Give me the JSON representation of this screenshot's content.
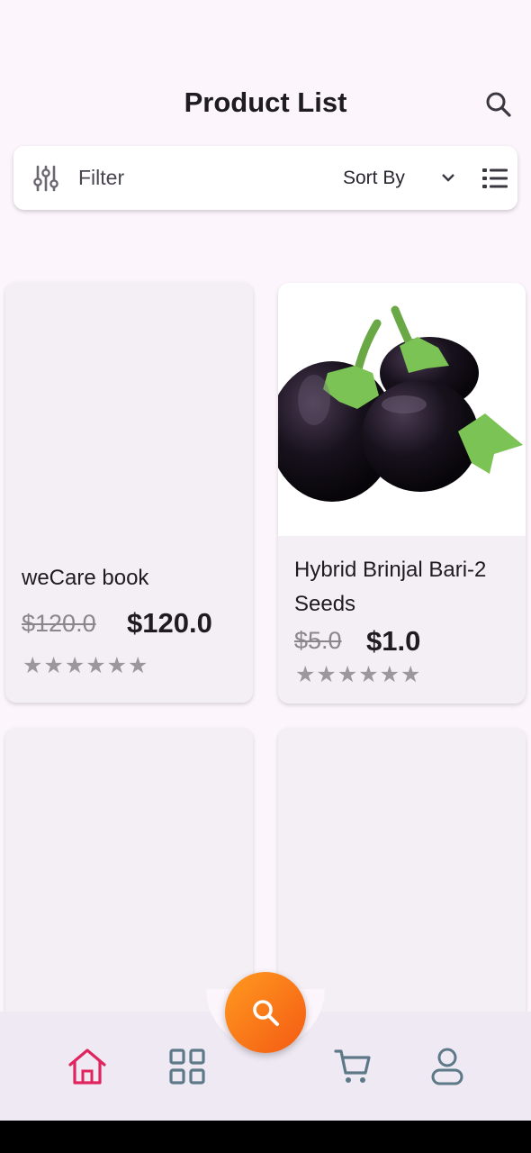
{
  "header": {
    "title": "Product List"
  },
  "toolbar": {
    "filter_label": "Filter",
    "sort_label": "Sort By"
  },
  "products": [
    {
      "name": "weCare book",
      "old_price": "$120.0",
      "price": "$120.0",
      "rating": "★★★★★★",
      "image": ""
    },
    {
      "name": "Hybrid Brinjal Bari-2 Seeds",
      "old_price": "$5.0",
      "price": "$1.0",
      "rating": "★★★★★★",
      "image": "eggplant-photo"
    },
    {
      "name": "",
      "old_price": "",
      "price": "",
      "rating": "",
      "image": ""
    },
    {
      "name": "",
      "old_price": "",
      "price": "",
      "rating": "",
      "image": ""
    }
  ],
  "bottom_nav": {
    "items": [
      "home-icon",
      "grid-icon",
      "cart-icon",
      "profile-icon"
    ],
    "active": "home-icon",
    "fab": "search-icon"
  },
  "colors": {
    "background": "#fcf5fc",
    "card": "#f3eff5",
    "active_nav": "#e0245e",
    "inactive_nav": "#5d7988",
    "fab_gradient_start": "#ff9a1f",
    "fab_gradient_end": "#f45a14",
    "star": "#9a979d"
  }
}
